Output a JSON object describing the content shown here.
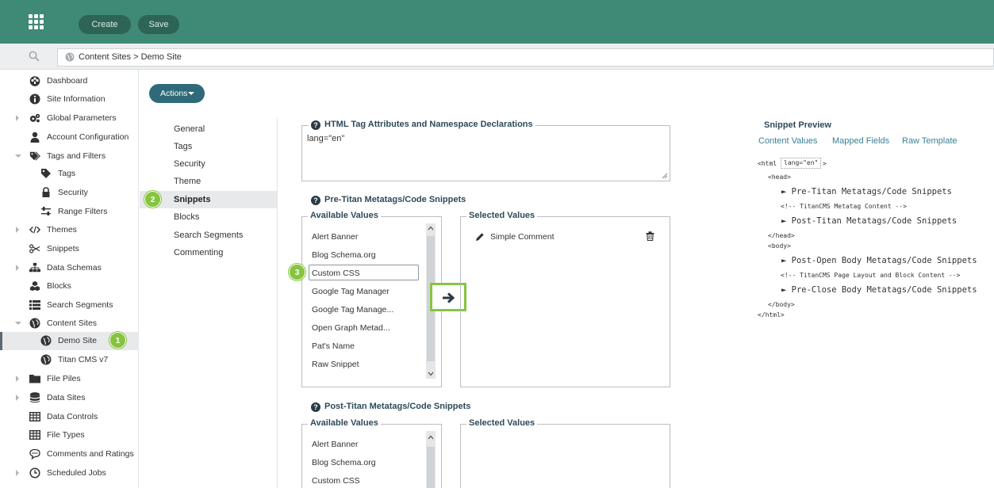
{
  "topbar": {
    "create_label": "Create",
    "save_label": "Save",
    "bg_color": "#3f8a77"
  },
  "breadcrumb": {
    "text": "Content Sites > Demo Site"
  },
  "leftnav": {
    "items": [
      {
        "label": "Dashboard",
        "icon": "dashboard-icon"
      },
      {
        "label": "Site Information",
        "icon": "info-icon"
      },
      {
        "label": "Global Parameters",
        "icon": "gears-icon"
      },
      {
        "label": "Account Configuration",
        "icon": "user-icon"
      },
      {
        "label": "Tags and Filters",
        "icon": "tags-icon"
      },
      {
        "label": "Tags",
        "icon": "tag-icon"
      },
      {
        "label": "Security",
        "icon": "lock-icon"
      },
      {
        "label": "Range Filters",
        "icon": "sliders-icon"
      },
      {
        "label": "Themes",
        "icon": "code-icon"
      },
      {
        "label": "Snippets",
        "icon": "scissors-icon"
      },
      {
        "label": "Data Schemas",
        "icon": "sitemap-icon"
      },
      {
        "label": "Blocks",
        "icon": "cubes-icon"
      },
      {
        "label": "Search Segments",
        "icon": "list-icon"
      },
      {
        "label": "Content Sites",
        "icon": "globe-icon"
      },
      {
        "label": "Demo Site",
        "icon": "globe-icon"
      },
      {
        "label": "Titan CMS v7",
        "icon": "globe-icon"
      },
      {
        "label": "File Piles",
        "icon": "folder-icon"
      },
      {
        "label": "Data Sites",
        "icon": "database-icon"
      },
      {
        "label": "Data Controls",
        "icon": "table-icon"
      },
      {
        "label": "File Types",
        "icon": "table-icon"
      },
      {
        "label": "Comments and Ratings",
        "icon": "comment-icon"
      },
      {
        "label": "Scheduled Jobs",
        "icon": "clock-icon"
      }
    ]
  },
  "actions_label": "Actions",
  "subnav": {
    "items": [
      "General",
      "Tags",
      "Security",
      "Theme",
      "Snippets",
      "Blocks",
      "Search Segments",
      "Commenting"
    ]
  },
  "badges": {
    "b1": "1",
    "b2": "2",
    "b3": "3"
  },
  "html_attrs": {
    "title": "HTML Tag Attributes and Namespace Declarations",
    "value": "lang=\"en\""
  },
  "pre_titan": {
    "title": "Pre-Titan Metatags/Code Snippets",
    "available_legend": "Available Values",
    "selected_legend": "Selected Values",
    "available": [
      "Alert Banner",
      "Blog Schema.org",
      "Custom CSS",
      "Google Tag Manager",
      "Google Tag Manage...",
      "Open Graph Metad...",
      "Pat's Name",
      "Raw Snippet"
    ],
    "selected": [
      "Simple Comment"
    ]
  },
  "post_titan": {
    "title": "Post-Titan Metatags/Code Snippets",
    "available_legend": "Available Values",
    "selected_legend": "Selected Values",
    "available": [
      "Alert Banner",
      "Blog Schema.org",
      "Custom CSS"
    ]
  },
  "preview": {
    "title": "Snippet Preview",
    "tabs": [
      "Content Values",
      "Mapped Fields",
      "Raw Template"
    ],
    "lines": {
      "html_open": "<html",
      "lang_attr": "lang=\"en\"",
      "html_close_bracket": ">",
      "head_open": "<head>",
      "pre_titan": "► Pre-Titan Metatags/Code Snippets",
      "metatag_comment": "<!-- TitanCMS Metatag Content -->",
      "post_titan": "► Post-Titan Metatags/Code Snippets",
      "head_close": "</head>",
      "body_open": "<body>",
      "post_open_body": "► Post-Open Body Metatags/Code Snippets",
      "layout_comment": "<!-- TitanCMS Page Layout and Block Content -->",
      "pre_close_body": "► Pre-Close Body Metatags/Code Snippets",
      "body_close": "</body>",
      "html_close": "</html>"
    }
  }
}
